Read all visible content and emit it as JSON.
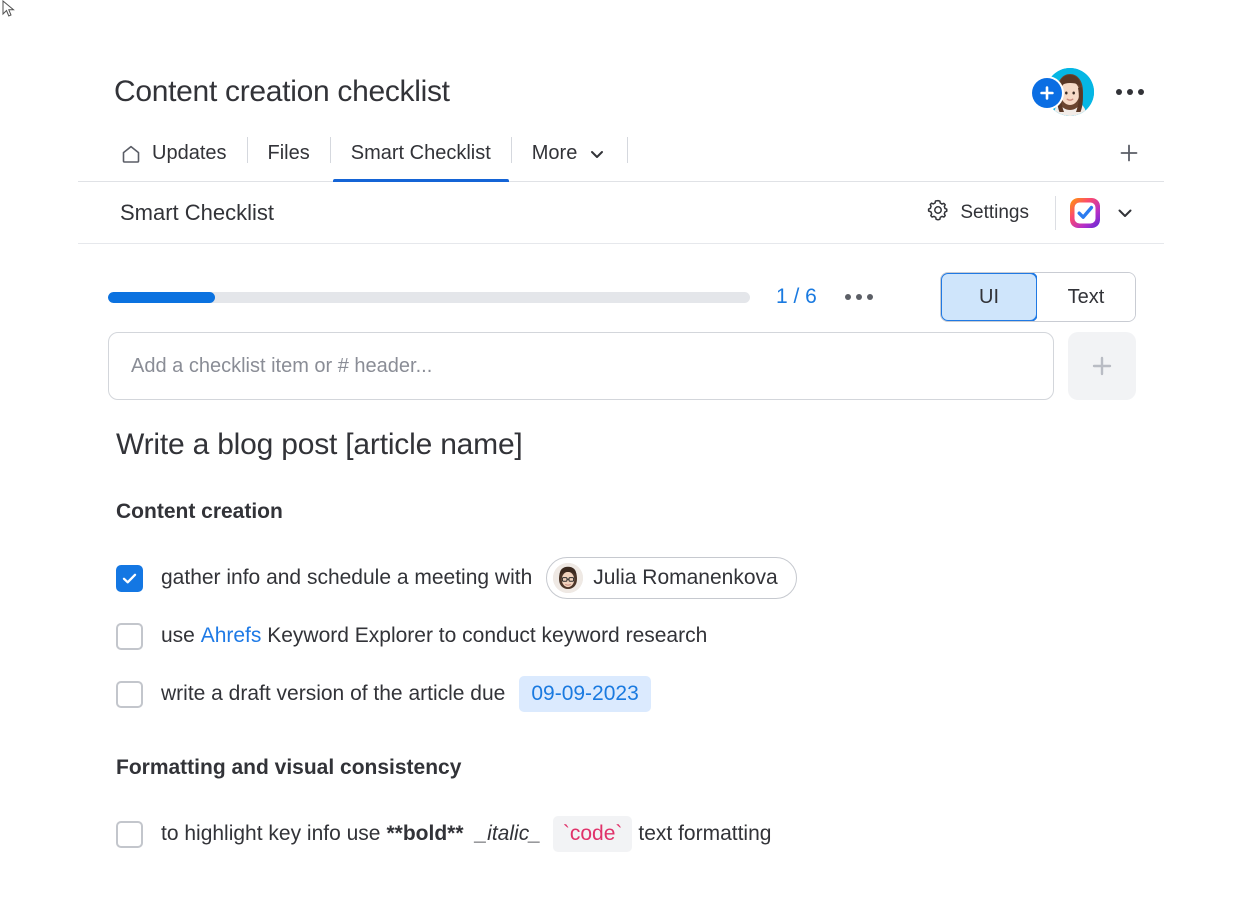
{
  "header": {
    "board_title": "Content creation checklist",
    "avatar_name": "user-avatar",
    "add_person_icon": "plus-circle-icon",
    "more_menu_icon": "ellipsis-icon"
  },
  "tabs": {
    "items": [
      {
        "label": "Updates",
        "icon": "home-icon",
        "active": false
      },
      {
        "label": "Files",
        "icon": "",
        "active": false
      },
      {
        "label": "Smart Checklist",
        "icon": "",
        "active": true
      },
      {
        "label": "More",
        "icon": "chevron-down-icon",
        "active": false
      }
    ],
    "add_tab_label": "+"
  },
  "widget": {
    "title": "Smart Checklist",
    "settings_label": "Settings",
    "settings_icon": "gear-icon",
    "app_logo": "smart-checklist-logo",
    "logo_chevron": "chevron-down-icon"
  },
  "progress": {
    "completed": 1,
    "total": 6,
    "counter_label": "1 / 6",
    "percent": 16.6,
    "fill_color": "#0b72e0",
    "track_color": "#e4e6ea",
    "counter_color": "#1a7ae0",
    "menu_icon": "ellipsis-icon"
  },
  "view_toggle": {
    "options": [
      {
        "label": "UI",
        "selected": true
      },
      {
        "label": "Text",
        "selected": false
      }
    ],
    "selected_bg": "#cfe5fb",
    "selected_border": "#2079e3"
  },
  "add_item": {
    "placeholder": "Add a checklist item or # header...",
    "value": "",
    "add_button_icon": "plus-icon"
  },
  "checklist": {
    "title": "Write a blog post [article name]",
    "sections": [
      {
        "heading": "Content creation",
        "items": [
          {
            "checked": true,
            "text_before": "gather info and schedule a meeting with",
            "person_chip": "Julia Romanenkova",
            "link": "",
            "date_chip": ""
          },
          {
            "checked": false,
            "text_before": "use ",
            "link": "Ahrefs",
            "text_after": " Keyword Explorer to conduct keyword research",
            "person_chip": "",
            "date_chip": ""
          },
          {
            "checked": false,
            "text_before": "write a draft version of the article due",
            "date_chip": "09-09-2023",
            "person_chip": "",
            "link": ""
          }
        ]
      },
      {
        "heading": "Formatting and visual consistency",
        "items": [
          {
            "checked": false,
            "text_before": "to highlight key info use",
            "md_bold": "**bold**",
            "md_italic": "_italic_",
            "md_code": "`code`",
            "text_after": "text formatting"
          }
        ]
      }
    ]
  }
}
